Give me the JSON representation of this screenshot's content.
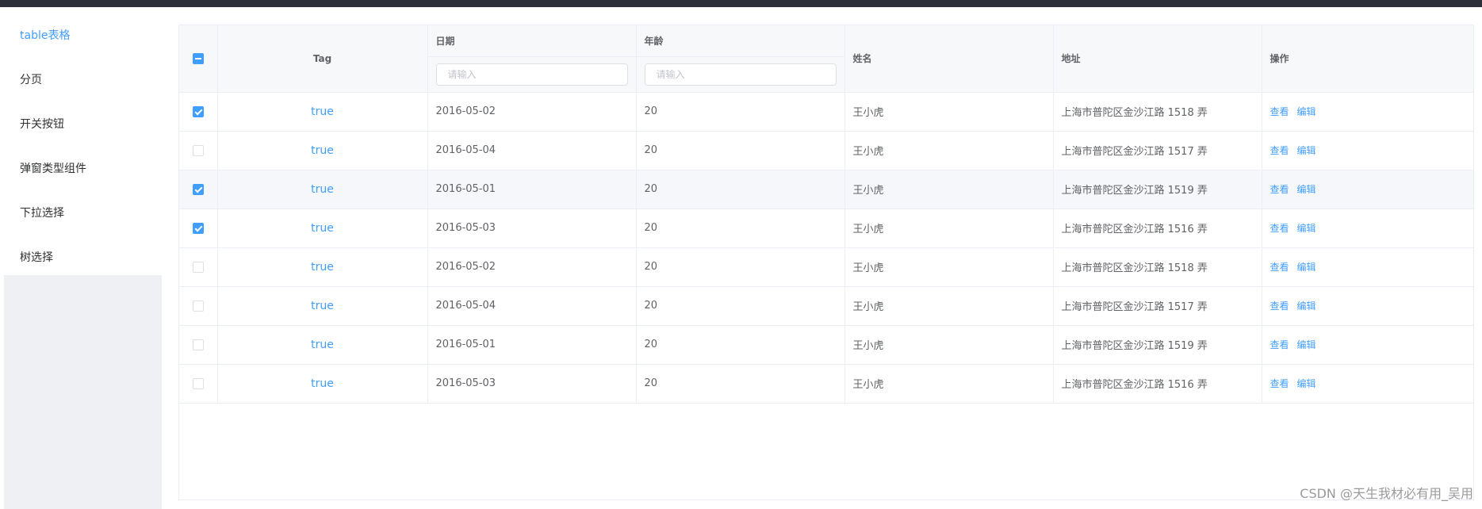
{
  "menu": {
    "items": [
      {
        "label": "table表格",
        "active": true
      },
      {
        "label": "分页"
      },
      {
        "label": "开关按钮"
      },
      {
        "label": "弹窗类型组件"
      },
      {
        "label": "下拉选择"
      },
      {
        "label": "树选择"
      }
    ]
  },
  "table": {
    "header_checkbox_state": "indeterminate",
    "headers": {
      "tag": "Tag",
      "date": "日期",
      "age": "年龄",
      "name": "姓名",
      "address": "地址",
      "ops": "操作"
    },
    "date_filter_placeholder": "请输入",
    "age_filter_placeholder": "请输入",
    "view_label": "查看",
    "edit_label": "编辑",
    "rows": [
      {
        "checked": true,
        "tag": "true",
        "date": "2016-05-02",
        "age": "20",
        "name": "王小虎",
        "address": "上海市普陀区金沙江路 1518 弄"
      },
      {
        "checked": false,
        "tag": "true",
        "date": "2016-05-04",
        "age": "20",
        "name": "王小虎",
        "address": "上海市普陀区金沙江路 1517 弄"
      },
      {
        "checked": true,
        "tag": "true",
        "date": "2016-05-01",
        "age": "20",
        "name": "王小虎",
        "address": "上海市普陀区金沙江路 1519 弄"
      },
      {
        "checked": true,
        "tag": "true",
        "date": "2016-05-03",
        "age": "20",
        "name": "王小虎",
        "address": "上海市普陀区金沙江路 1516 弄"
      },
      {
        "checked": false,
        "tag": "true",
        "date": "2016-05-02",
        "age": "20",
        "name": "王小虎",
        "address": "上海市普陀区金沙江路 1518 弄"
      },
      {
        "checked": false,
        "tag": "true",
        "date": "2016-05-04",
        "age": "20",
        "name": "王小虎",
        "address": "上海市普陀区金沙江路 1517 弄"
      },
      {
        "checked": false,
        "tag": "true",
        "date": "2016-05-01",
        "age": "20",
        "name": "王小虎",
        "address": "上海市普陀区金沙江路 1519 弄"
      },
      {
        "checked": false,
        "tag": "true",
        "date": "2016-05-03",
        "age": "20",
        "name": "王小虎",
        "address": "上海市普陀区金沙江路 1516 弄"
      }
    ]
  },
  "watermark": "CSDN @天生我材必有用_吴用",
  "colors": {
    "accent": "#409eff",
    "topbar": "#2d3038",
    "sidebar_bg": "#eef0f3",
    "header_bg": "#f7f8fa",
    "row_highlight": "#f5f7fa"
  }
}
